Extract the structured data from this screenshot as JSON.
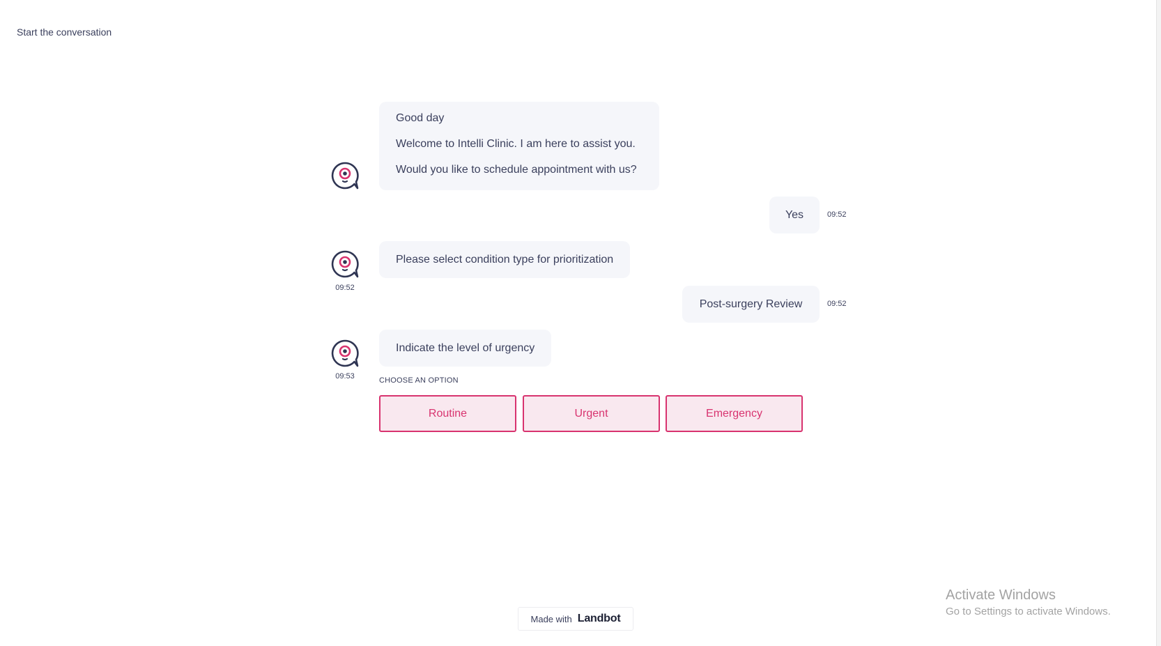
{
  "header": {
    "title": "Start the conversation"
  },
  "colors": {
    "accent": "#d8336f",
    "bubble_bg": "#f5f6fa",
    "text": "#3a3f5c",
    "option_bg": "#f9e8ef"
  },
  "conversation": {
    "bot_icon": "chat-bubble-eye-icon",
    "messages": [
      {
        "sender": "bot",
        "lines": [
          "Good day",
          "Welcome to Intelli Clinic. I am here to assist you.",
          "Would you like to schedule appointment with us?"
        ],
        "time": ""
      },
      {
        "sender": "user",
        "text": "Yes",
        "time": "09:52"
      },
      {
        "sender": "bot",
        "text": "Please select condition type for prioritization",
        "time": "09:52"
      },
      {
        "sender": "user",
        "text": "Post-surgery Review",
        "time": "09:52"
      },
      {
        "sender": "bot",
        "text": "Indicate the level of urgency",
        "time": "09:53"
      }
    ]
  },
  "options": {
    "label": "CHOOSE AN OPTION",
    "buttons": [
      "Routine",
      "Urgent",
      "Emergency"
    ]
  },
  "footer": {
    "made_with": "Made with",
    "brand": "Landbot"
  },
  "os_watermark": {
    "title": "Activate Windows",
    "subtitle": "Go to Settings to activate Windows."
  }
}
